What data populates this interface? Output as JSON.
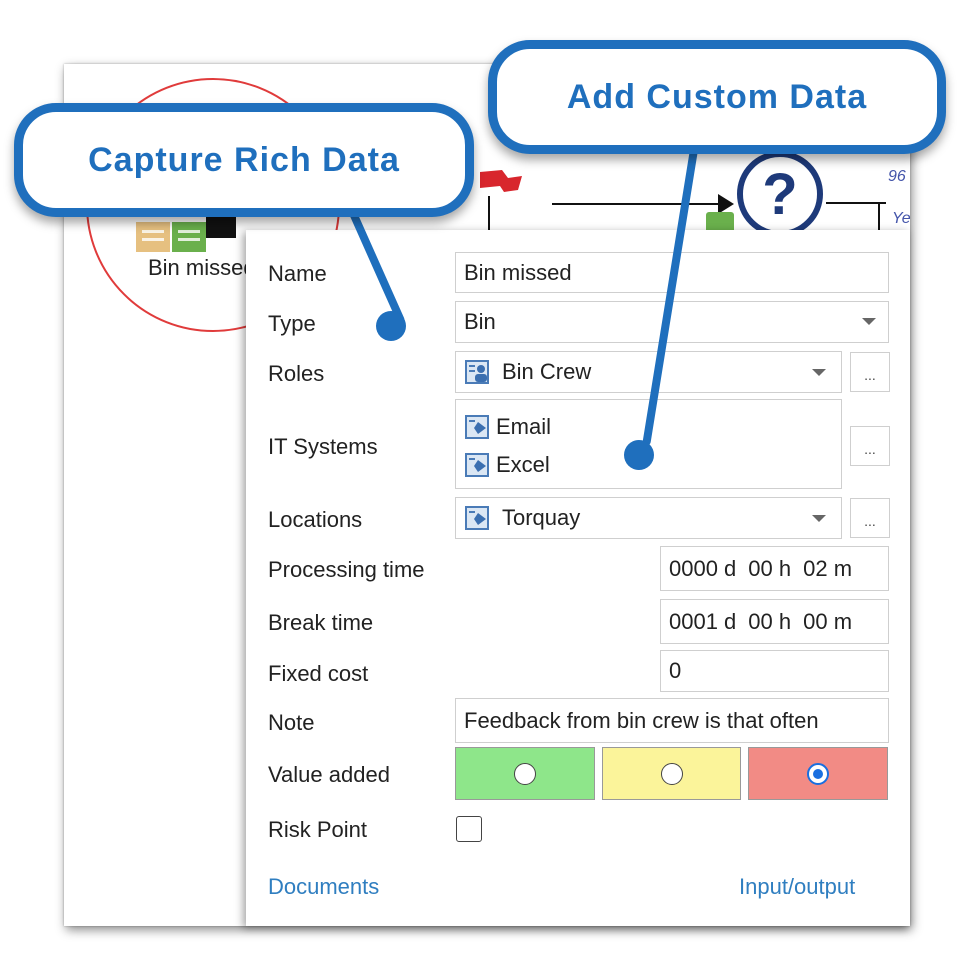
{
  "callouts": {
    "capture": "Capture Rich Data",
    "custom": "Add Custom Data"
  },
  "diagram": {
    "node_label": "Bin missed",
    "side_text_1": "96",
    "side_text_2": "Ye"
  },
  "form": {
    "name_label": "Name",
    "name_value": "Bin missed",
    "type_label": "Type",
    "type_value": "Bin",
    "roles_label": "Roles",
    "roles_value": "Bin Crew",
    "it_label": "IT Systems",
    "it_items": [
      "Email",
      "Excel"
    ],
    "locations_label": "Locations",
    "locations_value": "Torquay",
    "processing_label": "Processing time",
    "processing": {
      "d": "0000 d",
      "h": "00 h",
      "m": "02 m"
    },
    "break_label": "Break time",
    "break": {
      "d": "0001 d",
      "h": "00 h",
      "m": "00 m"
    },
    "fixed_label": "Fixed cost",
    "fixed_value": "0",
    "note_label": "Note",
    "note_value": "Feedback from bin crew is that often",
    "value_added_label": "Value added",
    "value_added_selected": "red",
    "risk_label": "Risk Point",
    "risk_checked": false,
    "ellipsis": "...",
    "documents_link": "Documents",
    "io_link": "Input/output"
  },
  "colors": {
    "callout_blue": "#1f6fbd",
    "value_green": "#8ee68a",
    "value_yellow": "#fbf49a",
    "value_red": "#f28b85",
    "link": "#2f7ec0"
  }
}
